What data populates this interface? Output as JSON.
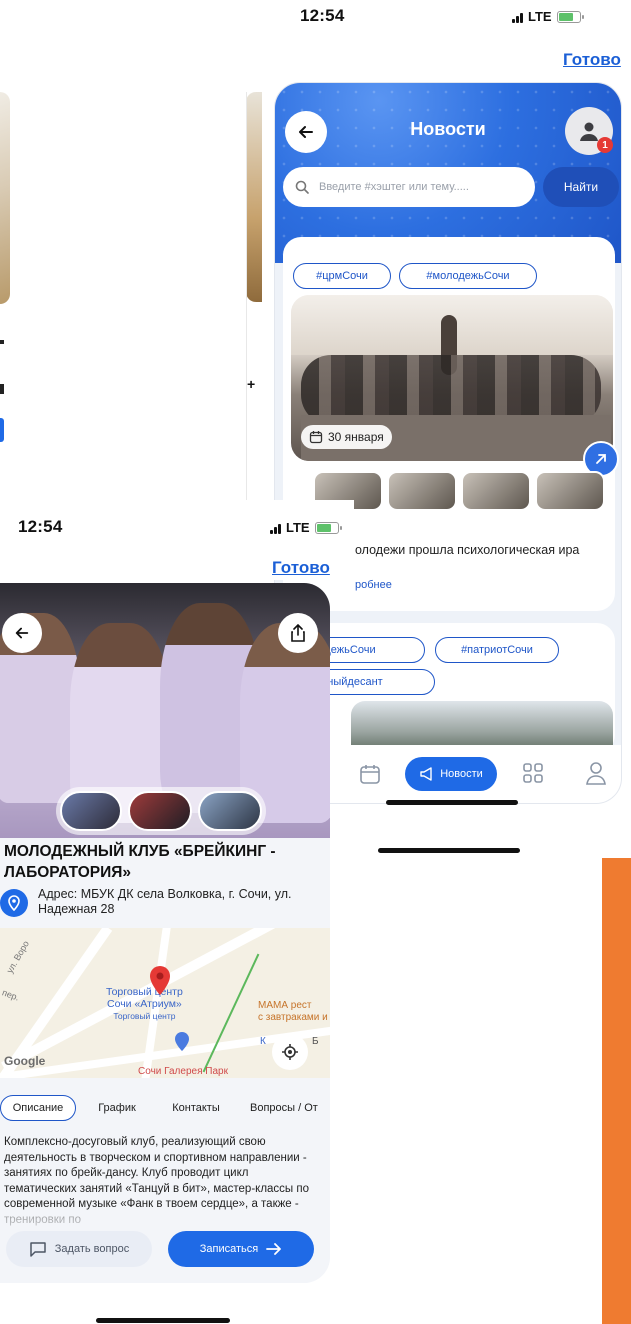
{
  "status_bar_top": {
    "time": "12:54",
    "network": "LTE"
  },
  "status_bar_bottom": {
    "time": "12:54",
    "network": "LTE"
  },
  "done_link_top": "Готово",
  "done_link_bottom": "Готово",
  "news": {
    "header_title": "Новости",
    "notification_count": "1",
    "search_placeholder": "Введите #хэштег или тему.....",
    "find_button": "Найти",
    "card1": {
      "tags": [
        "#црмСочи",
        "#молодежьСочи"
      ],
      "date": "30 января",
      "text": "олодежи прошла психологическая ира",
      "more": "робнее"
    },
    "card2": {
      "tags": [
        "дежьСочи",
        "#патриотСочи",
        "ныйдесант"
      ]
    },
    "tabbar": {
      "active_label": "Новости"
    }
  },
  "club": {
    "title": "МОЛОДЕЖНЫЙ КЛУБ «БРЕЙКИНГ - ЛАБОРАТОРИЯ»",
    "address": "Адрес: МБУК ДК села Волковка, г. Сочи, ул. Надежная 28",
    "map": {
      "poi_mall": "Торговый центр",
      "poi_mall_name": "Сочи «Атриум»",
      "poi_mall_sub": "Торговый центр",
      "poi_mama": "МАМА рест",
      "poi_mama_sub": "с завтраками и биз",
      "street_1": "ул. Воро",
      "street_2": "пер.",
      "poi_gallery": "Сочи Галерея Парк",
      "poi_right": "К",
      "poi_right_2": "Б",
      "google": "Google"
    },
    "tabs": [
      "Описание",
      "График",
      "Контакты",
      "Вопросы / От"
    ],
    "description": "Комплексно-досуговый клуб, реализующий свою деятельность в творческом и спортивном направлении - занятиях по брейк-дансу. Клуб проводит цикл тематических занятий «Танцуй в бит», мастер-классы по современной музыке «Фанк в твоем сердце», а также - тренировки по",
    "ask_button": "Задать вопрос",
    "signup_button": "Записаться"
  },
  "colors": {
    "accent": "#1f6ae6",
    "accent_dark": "#1f4fb8",
    "orange_strip": "#ef7b30",
    "badge": "#e53935"
  }
}
